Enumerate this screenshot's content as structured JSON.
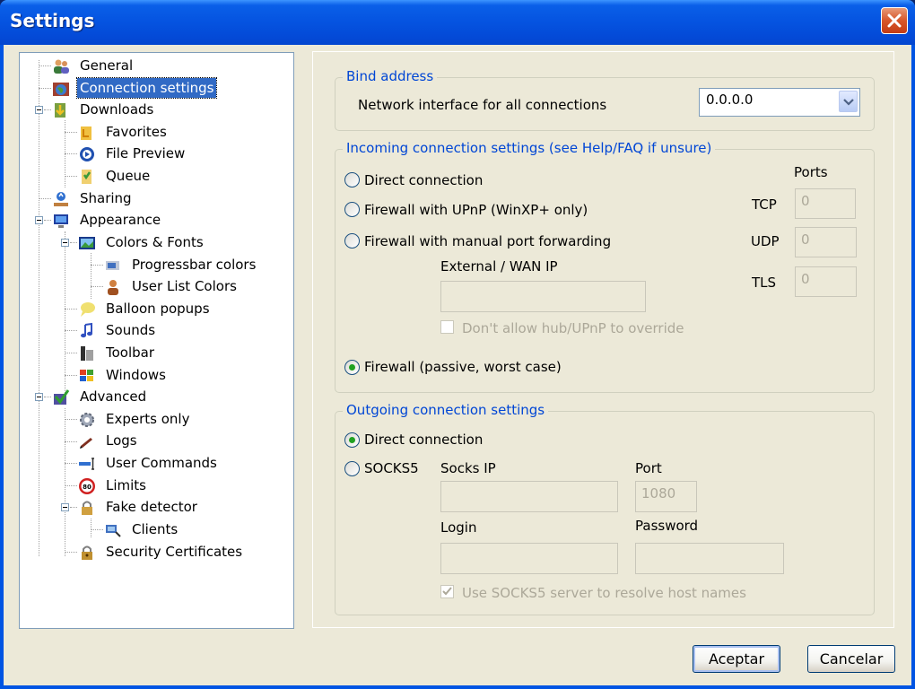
{
  "window": {
    "title": "Settings"
  },
  "tree": {
    "items": [
      {
        "label": "General",
        "icon": "users-icon"
      },
      {
        "label": "Connection settings",
        "icon": "globe-icon",
        "selected": true
      },
      {
        "label": "Downloads",
        "icon": "downloads-icon"
      },
      {
        "label": "Favorites",
        "icon": "favorites-icon"
      },
      {
        "label": "File Preview",
        "icon": "preview-icon"
      },
      {
        "label": "Queue",
        "icon": "queue-icon"
      },
      {
        "label": "Sharing",
        "icon": "sharing-icon"
      },
      {
        "label": "Appearance",
        "icon": "monitor-icon"
      },
      {
        "label": "Colors & Fonts",
        "icon": "picture-icon"
      },
      {
        "label": "Progressbar colors",
        "icon": "progressbar-icon"
      },
      {
        "label": "User List Colors",
        "icon": "user-icon"
      },
      {
        "label": "Balloon popups",
        "icon": "balloon-icon"
      },
      {
        "label": "Sounds",
        "icon": "music-note-icon"
      },
      {
        "label": "Toolbar",
        "icon": "toolbar-icon"
      },
      {
        "label": "Windows",
        "icon": "windows-flag-icon"
      },
      {
        "label": "Advanced",
        "icon": "checkmark-icon"
      },
      {
        "label": "Experts only",
        "icon": "gear-icon"
      },
      {
        "label": "Logs",
        "icon": "pen-icon"
      },
      {
        "label": "User Commands",
        "icon": "command-icon"
      },
      {
        "label": "Limits",
        "icon": "speed-limit-icon"
      },
      {
        "label": "Fake detector",
        "icon": "lock-icon"
      },
      {
        "label": "Clients",
        "icon": "clients-icon"
      },
      {
        "label": "Security Certificates",
        "icon": "certificate-lock-icon"
      }
    ]
  },
  "bind": {
    "legend": "Bind address",
    "label": "Network interface for all connections",
    "value": "0.0.0.0"
  },
  "incoming": {
    "legend": "Incoming connection settings (see Help/FAQ if unsure)",
    "direct": "Direct connection",
    "upnp": "Firewall with UPnP (WinXP+ only)",
    "manual": "Firewall with manual port forwarding",
    "wan_label": "External / WAN IP",
    "wan_value": "",
    "override": "Don't allow hub/UPnP to override",
    "passive": "Firewall (passive, worst case)",
    "selected": "passive",
    "ports_label": "Ports",
    "tcp_label": "TCP",
    "tcp_value": "0",
    "udp_label": "UDP",
    "udp_value": "0",
    "tls_label": "TLS",
    "tls_value": "0"
  },
  "outgoing": {
    "legend": "Outgoing connection settings",
    "direct": "Direct connection",
    "socks5": "SOCKS5",
    "selected": "direct",
    "socks_ip_label": "Socks IP",
    "socks_ip_value": "",
    "port_label": "Port",
    "port_value": "1080",
    "login_label": "Login",
    "login_value": "",
    "password_label": "Password",
    "password_value": "",
    "resolve": "Use SOCKS5 server to resolve host names",
    "resolve_checked": true
  },
  "buttons": {
    "ok": "Aceptar",
    "cancel": "Cancelar"
  },
  "colors": {
    "title_blue": "#0553e0",
    "legend_blue": "#0046d5",
    "selection": "#316ac5",
    "radio_green": "#21a121"
  }
}
